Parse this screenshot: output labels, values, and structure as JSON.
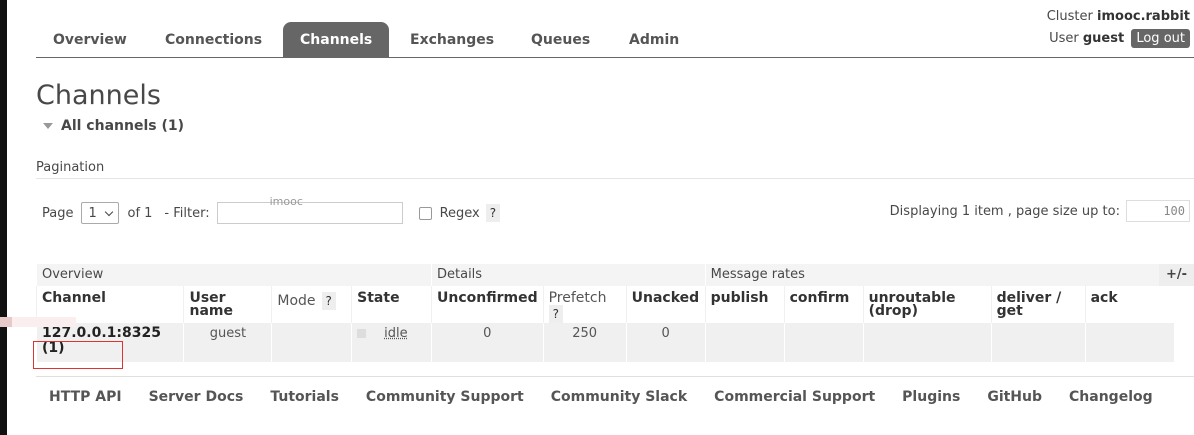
{
  "header": {
    "cluster_label": "Cluster",
    "cluster_name": "imooc.rabbit",
    "user_label": "User",
    "user_name": "guest",
    "logout_label": "Log out"
  },
  "tabs": [
    {
      "label": "Overview"
    },
    {
      "label": "Connections"
    },
    {
      "label": "Channels",
      "active": true
    },
    {
      "label": "Exchanges"
    },
    {
      "label": "Queues"
    },
    {
      "label": "Admin"
    }
  ],
  "page_title": "Channels",
  "section_toggle": "All channels (1)",
  "pagination": {
    "label": "Pagination",
    "page_label": "Page",
    "page_value": "1",
    "of_label": "of 1",
    "filter_label": "- Filter:",
    "filter_value": "imooc",
    "regex_label": "Regex",
    "help": "?",
    "display_text": "Displaying 1 item , page size up to:",
    "page_size": "100"
  },
  "table": {
    "groups": [
      "Overview",
      "Details",
      "Message rates"
    ],
    "plus_minus": "+/-",
    "columns": {
      "channel": "Channel",
      "user_name": "User name",
      "mode": "Mode",
      "state": "State",
      "unconfirmed": "Unconfirmed",
      "prefetch": "Prefetch",
      "unacked": "Unacked",
      "publish": "publish",
      "confirm": "confirm",
      "unroutable": "unroutable (drop)",
      "deliver_get": "deliver / get",
      "ack": "ack"
    },
    "rows": [
      {
        "channel": "127.0.0.1:8325 (1)",
        "user_name": "guest",
        "mode": "",
        "state": "idle",
        "unconfirmed": "0",
        "prefetch": "250",
        "unacked": "0"
      }
    ]
  },
  "footer_links": [
    "HTTP API",
    "Server Docs",
    "Tutorials",
    "Community Support",
    "Community Slack",
    "Commercial Support",
    "Plugins",
    "GitHub",
    "Changelog"
  ]
}
